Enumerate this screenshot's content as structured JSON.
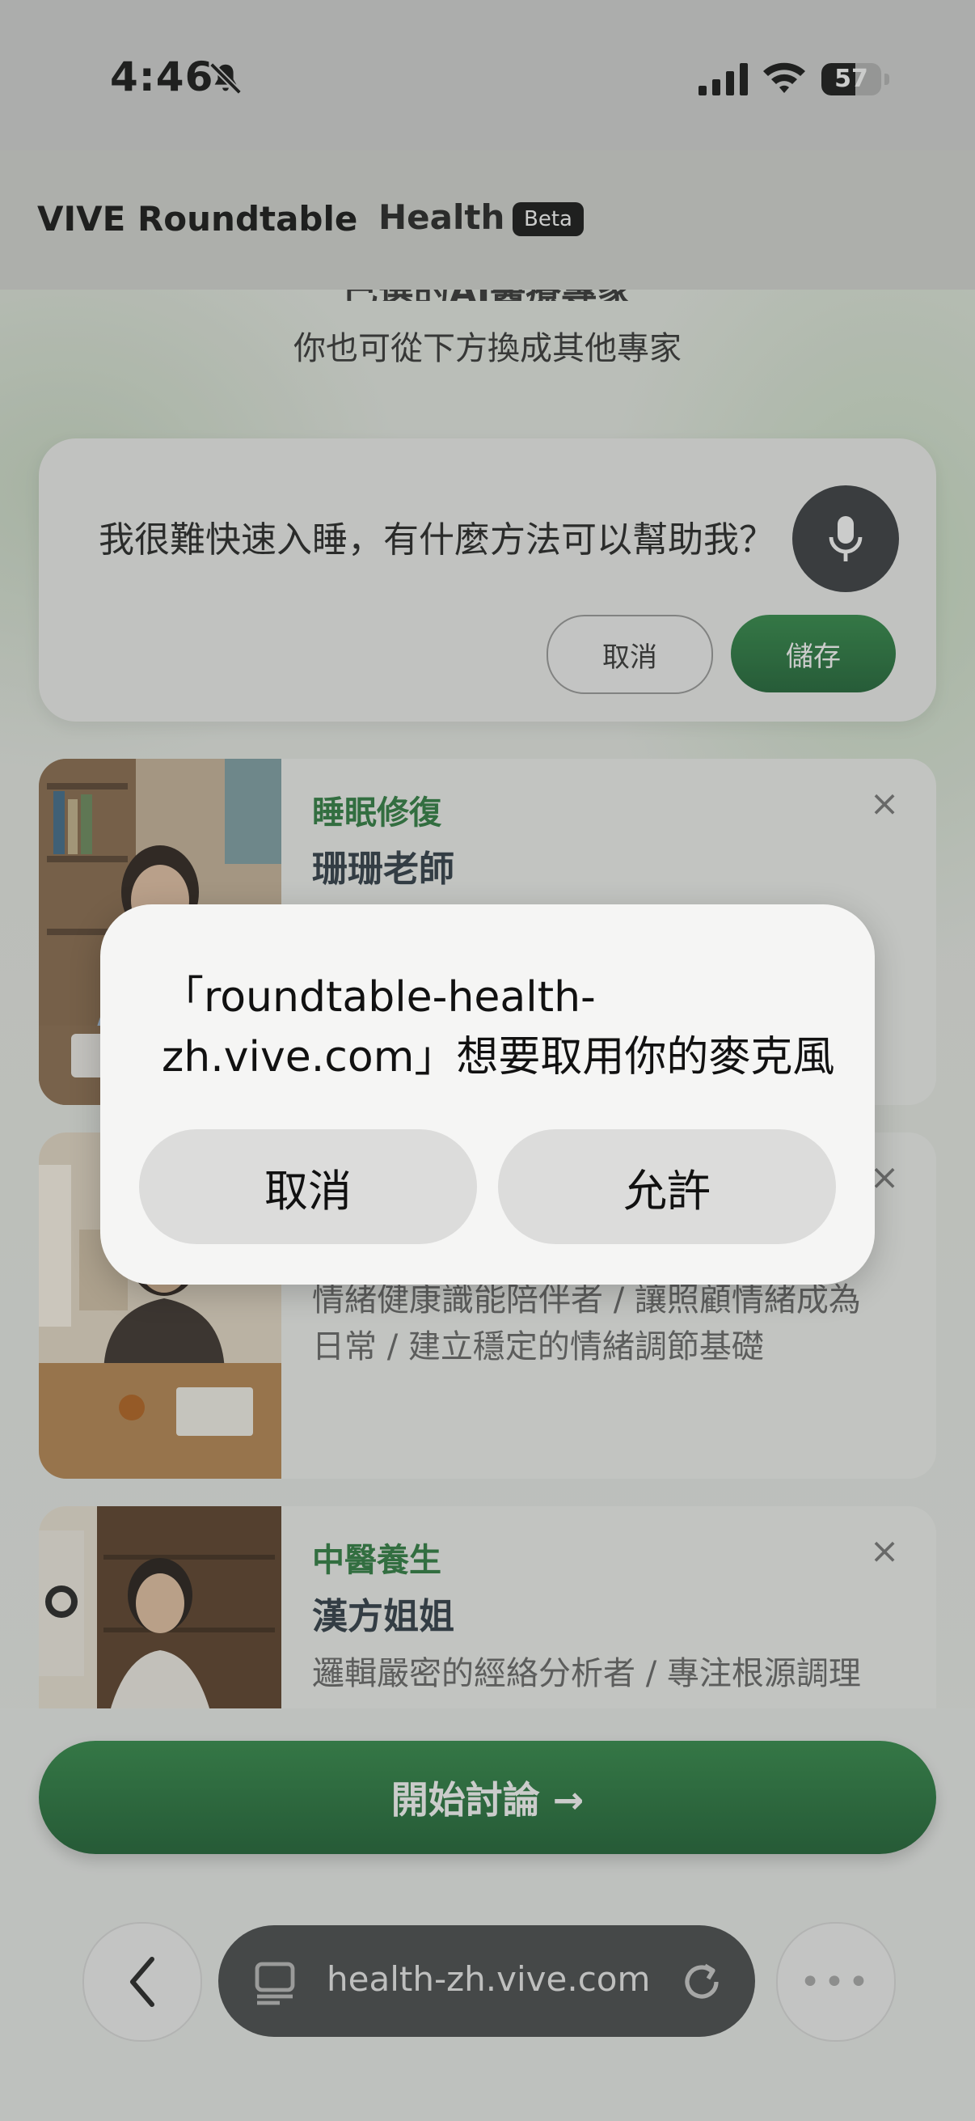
{
  "status_bar": {
    "time": "4:46",
    "battery": "57"
  },
  "header": {
    "brand": "VIVE Roundtable",
    "subtitle": "Health",
    "badge": "Beta"
  },
  "intro": {
    "heading_partial": "已選的AI醫療專家",
    "subtext": "你也可從下方換成其他專家"
  },
  "query_card": {
    "text": "我很難快速入睡，有什麼方法可以幫助我？",
    "cancel_label": "取消",
    "save_label": "儲存",
    "mic_icon": "microphone-icon"
  },
  "experts": [
    {
      "category": "睡眠修復",
      "name": "珊珊老師",
      "description": ""
    },
    {
      "category": "",
      "name": "",
      "description": "情緒健康識能陪伴者 / 讓照顧情緒成為日常 / 建立穩定的情緒調節基礎"
    },
    {
      "category": "中醫養生",
      "name": "漢方姐姐",
      "description": "邏輯嚴密的經絡分析者 / 專注根源調理"
    }
  ],
  "start_button": {
    "label": "開始討論 →"
  },
  "browser_bar": {
    "url": "health-zh.vive.com"
  },
  "dialog": {
    "message": "「roundtable-health-zh.vive.com」想要取用你的麥克風",
    "cancel_label": "取消",
    "allow_label": "允許"
  },
  "colors": {
    "accent_green": "#2b7d3f",
    "dark": "#36393e"
  }
}
